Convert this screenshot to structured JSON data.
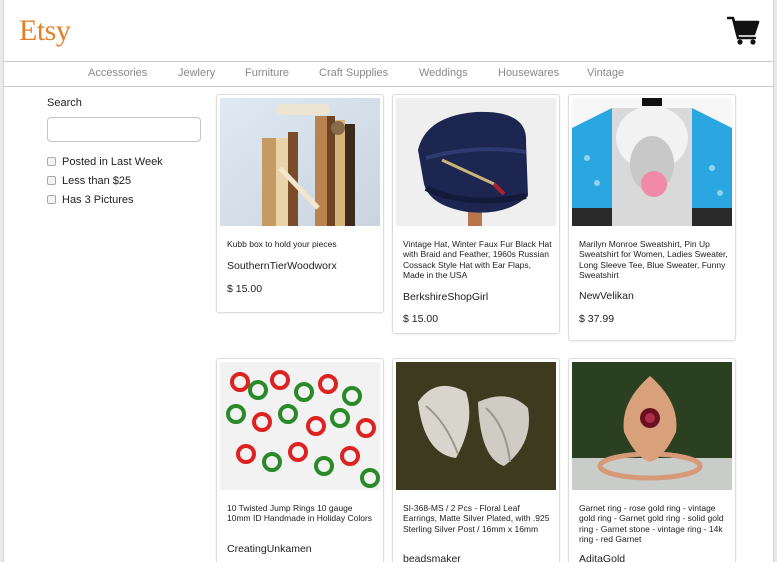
{
  "header": {
    "logo": "Etsy",
    "cart_icon": "shopping-cart-icon"
  },
  "nav": {
    "items": [
      {
        "label": "Accessories"
      },
      {
        "label": "Jewlery"
      },
      {
        "label": "Furniture"
      },
      {
        "label": "Craft Supplies"
      },
      {
        "label": "Weddings"
      },
      {
        "label": "Housewares"
      },
      {
        "label": "Vintage"
      }
    ]
  },
  "sidebar": {
    "search_label": "Search",
    "search_value": "",
    "filters": [
      {
        "label": "Posted in Last Week",
        "checked": false
      },
      {
        "label": "Less than $25",
        "checked": false
      },
      {
        "label": "Has 3 Pictures",
        "checked": false
      }
    ]
  },
  "listings": [
    {
      "title": "Kubb box to hold your pieces",
      "shop": "SouthernTierWoodworx",
      "price": "$ 15.00"
    },
    {
      "title": "Vintage Hat, Winter Faux Fur Black Hat with Braid and Feather, 1960s Russian Cossack Style Hat with Ear Flaps, Made in the USA",
      "shop": "BerkshireShopGirl",
      "price": "$ 15.00"
    },
    {
      "title": "Marilyn Monroe Sweatshirt, Pin Up Sweatshirt for Women, Ladies Sweater, Long Sleeve Tee, Blue Sweater, Funny Sweatshirt",
      "shop": "NewVelikan",
      "price": "$ 37.99"
    },
    {
      "title": "10 Twisted Jump Rings 10 gauge 10mm ID Handmade in Holiday Colors",
      "shop": "CreatingUnkamen",
      "price": ""
    },
    {
      "title": "SI-368-MS / 2 Pcs - Floral Leaf Earrings, Matte Silver Plated, with .925 Sterling Silver Post / 16mm x 16mm",
      "shop": "beadsmaker",
      "price": ""
    },
    {
      "title": "Garnet ring - rose gold ring - vintage gold ring - Garnet gold ring - solid gold ring - Garnet stone - vintage ring - 14k ring - red Garnet",
      "shop": "AditaGold",
      "price": ""
    }
  ],
  "colors": {
    "logo": "#e0812a",
    "nav_text": "#888888",
    "border": "#c9c9c9"
  }
}
